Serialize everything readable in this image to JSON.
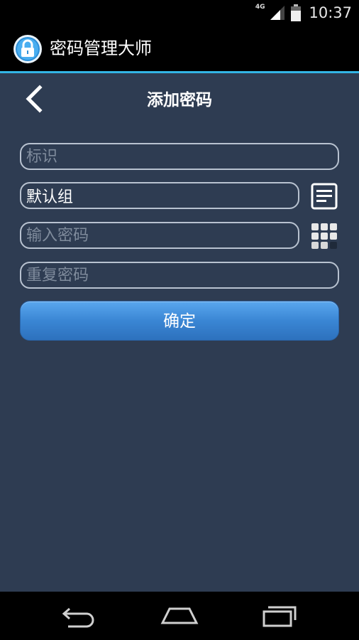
{
  "status_bar": {
    "network_type": "4G",
    "time": "10:37"
  },
  "action_bar": {
    "app_title": "密码管理大师",
    "app_icon": "padlock-icon"
  },
  "page": {
    "title": "添加密码",
    "back_icon": "chevron-left-icon"
  },
  "form": {
    "label_placeholder": "标识",
    "group_value": "默认组",
    "password_placeholder": "输入密码",
    "repeat_placeholder": "重复密码",
    "confirm_label": "确定",
    "group_list_icon": "list-icon",
    "keypad_icon": "keypad-icon"
  },
  "nav_bar": {
    "back_icon": "back-arrow-icon",
    "home_icon": "home-icon",
    "recent_icon": "recent-apps-icon"
  },
  "colors": {
    "accent": "#33b5e5",
    "content_bg": "#2e3c52",
    "button_blue": "#3a86d4"
  }
}
